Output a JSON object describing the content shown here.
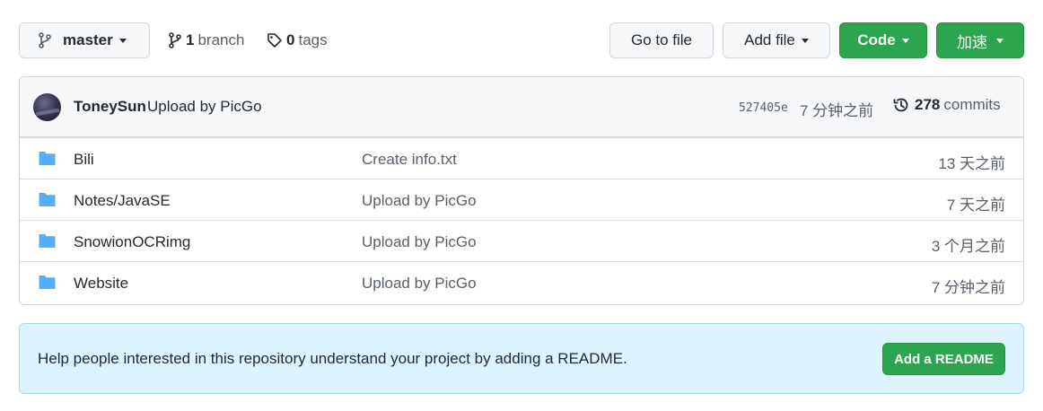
{
  "toolbar": {
    "branch_name": "master",
    "branch_count": "1",
    "branch_label": "branch",
    "tag_count": "0",
    "tag_label": "tags",
    "go_to_file": "Go to file",
    "add_file": "Add file",
    "code": "Code",
    "accelerate": "加速"
  },
  "latest_commit": {
    "author": "ToneySun",
    "message": "Upload by PicGo",
    "sha": "527405e",
    "time": "7 分钟之前",
    "commit_count": "278",
    "commit_label": "commits"
  },
  "files": [
    {
      "name": "Bili",
      "message": "Create info.txt",
      "age": "13 天之前"
    },
    {
      "name": "Notes/JavaSE",
      "message": "Upload by PicGo",
      "age": "7 天之前"
    },
    {
      "name": "SnowionOCRimg",
      "message": "Upload by PicGo",
      "age": "3 个月之前"
    },
    {
      "name": "Website",
      "message": "Upload by PicGo",
      "age": "7 分钟之前"
    }
  ],
  "readme": {
    "text": "Help people interested in this repository understand your project by adding a README.",
    "button": "Add a README"
  },
  "colors": {
    "green": "#2da44e",
    "folder_blue": "#54aeff",
    "readme_bg": "#ddf4ff"
  }
}
